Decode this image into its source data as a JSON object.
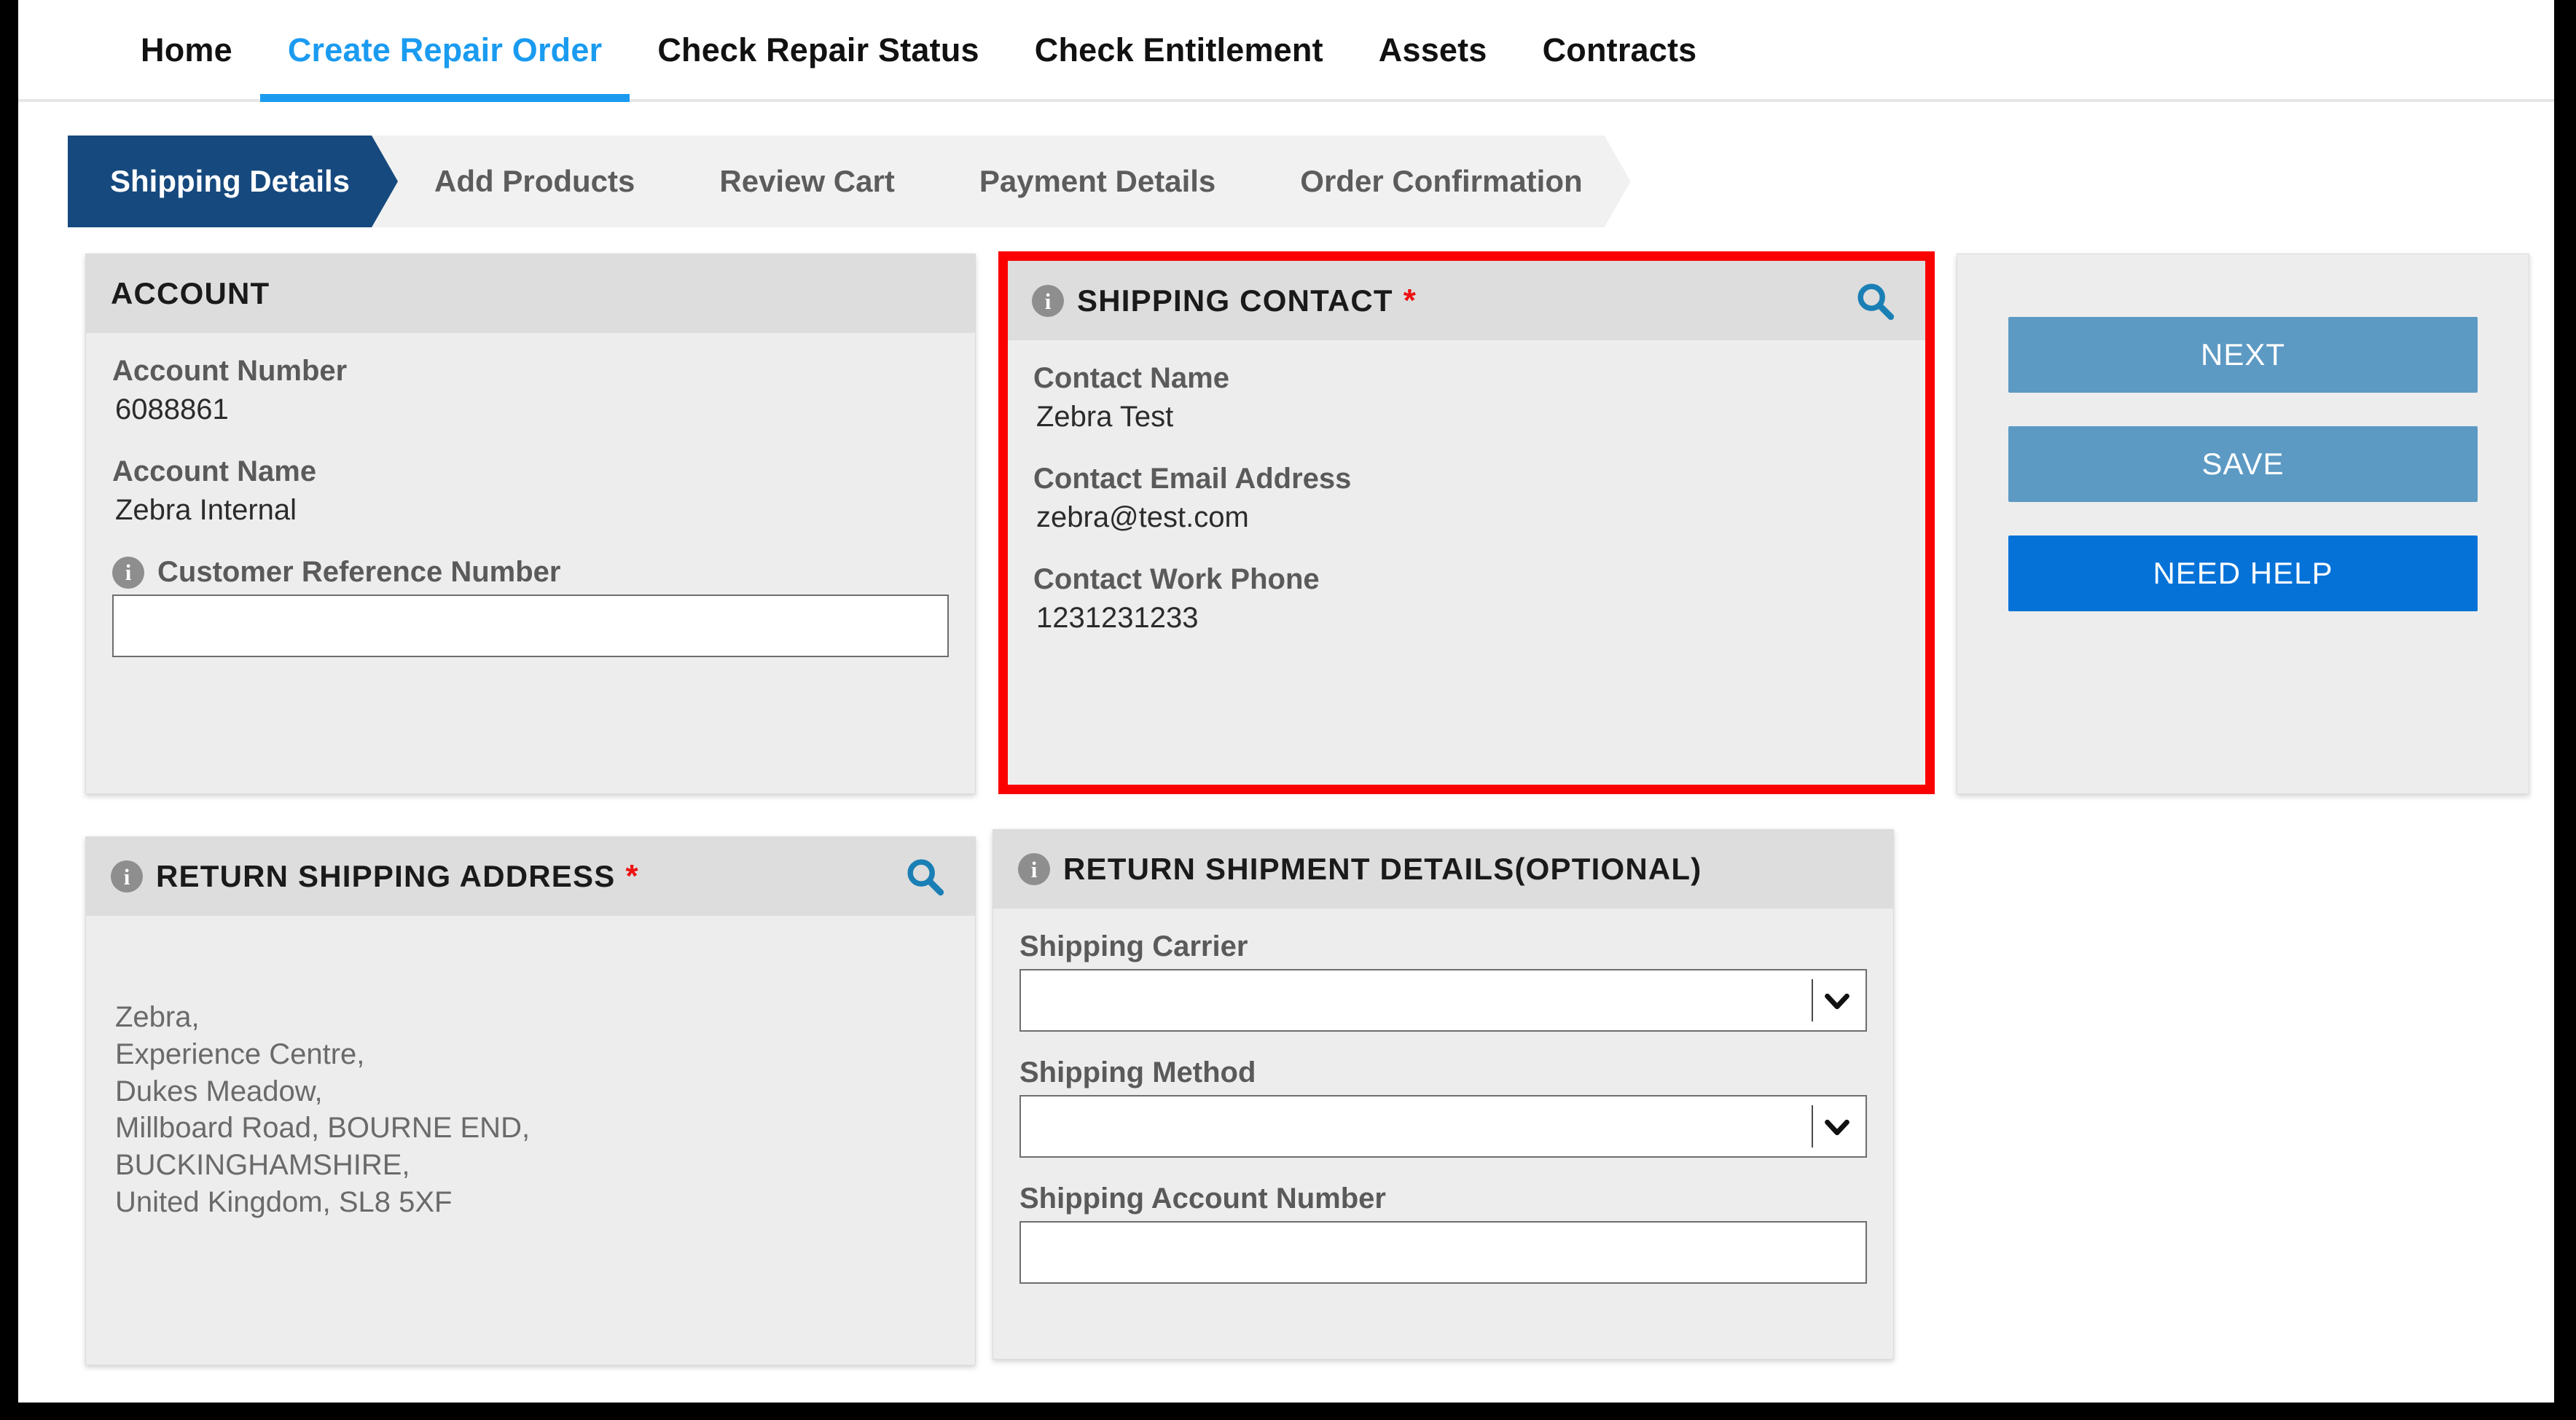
{
  "colors": {
    "active_tab": "#1a9bf0",
    "active_step": "#16497e",
    "inactive_step_bg": "#f1f1f1",
    "required_star": "#ee1111",
    "search_icon": "#1a7fb5",
    "info_icon": "#8e8e8e",
    "button_secondary": "#5c9ac4",
    "button_primary": "#0572d8",
    "annotation_box": "#fb0000",
    "card_header_bg": "#dddddd",
    "card_body_bg": "#ededed"
  },
  "nav": {
    "items": [
      {
        "label": "Home",
        "active": false
      },
      {
        "label": "Create Repair Order",
        "active": true
      },
      {
        "label": "Check Repair Status",
        "active": false
      },
      {
        "label": "Check Entitlement",
        "active": false
      },
      {
        "label": "Assets",
        "active": false
      },
      {
        "label": "Contracts",
        "active": false
      }
    ]
  },
  "stepper": {
    "steps": [
      {
        "label": "Shipping Details",
        "active": true
      },
      {
        "label": "Add Products",
        "active": false
      },
      {
        "label": "Review Cart",
        "active": false
      },
      {
        "label": "Payment Details",
        "active": false
      },
      {
        "label": "Order Confirmation",
        "active": false
      }
    ]
  },
  "account_card": {
    "title": "ACCOUNT",
    "account_number_label": "Account Number",
    "account_number_value": "6088861",
    "account_name_label": "Account Name",
    "account_name_value": "Zebra Internal",
    "customer_reference_label": "Customer Reference Number",
    "customer_reference_value": "",
    "customer_reference_placeholder": "",
    "info_glyph": "i"
  },
  "shipping_contact_card": {
    "title": "SHIPPING CONTACT",
    "required_marker": "*",
    "info_glyph": "i",
    "search_icon_name": "search-icon",
    "contact_name_label": "Contact Name",
    "contact_name_value": "Zebra Test",
    "contact_email_label": "Contact Email Address",
    "contact_email_value": "zebra@test.com",
    "contact_phone_label": "Contact Work Phone",
    "contact_phone_value": "1231231233"
  },
  "return_address_card": {
    "title": "RETURN SHIPPING ADDRESS",
    "required_marker": "*",
    "info_glyph": "i",
    "address_lines": [
      "Zebra,",
      "Experience Centre,",
      "Dukes Meadow,",
      "Millboard Road, BOURNE END,",
      "BUCKINGHAMSHIRE,",
      "United Kingdom, SL8 5XF"
    ]
  },
  "return_shipment_card": {
    "title": "RETURN SHIPMENT DETAILS(OPTIONAL)",
    "info_glyph": "i",
    "shipping_carrier_label": "Shipping Carrier",
    "shipping_carrier_value": "",
    "shipping_method_label": "Shipping Method",
    "shipping_method_value": "",
    "shipping_account_label": "Shipping Account Number",
    "shipping_account_value": "",
    "shipping_account_placeholder": ""
  },
  "actions": {
    "next_label": "NEXT",
    "save_label": "SAVE",
    "help_label": "NEED HELP"
  }
}
